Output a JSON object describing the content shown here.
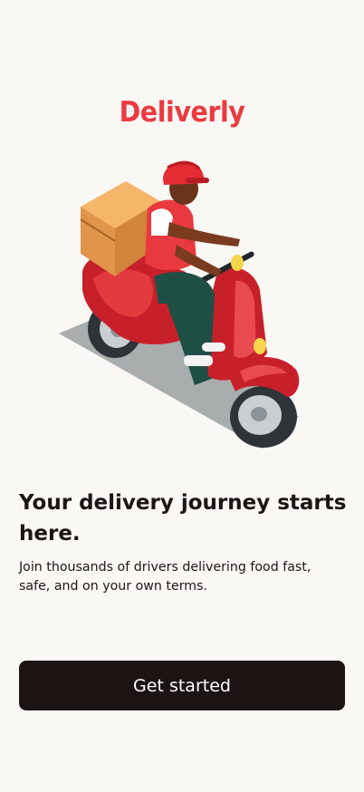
{
  "brand": {
    "name": "Deliverly",
    "color": "#ec3a40"
  },
  "hero": {
    "illustration": "scooter-delivery-rider-illustration"
  },
  "onboarding": {
    "headline": "Your delivery journey starts here.",
    "subtext": "Join thousands of drivers delivering food fast, safe, and on your own terms."
  },
  "actions": {
    "get_started_label": "Get started",
    "button_color": "#1c1413"
  }
}
